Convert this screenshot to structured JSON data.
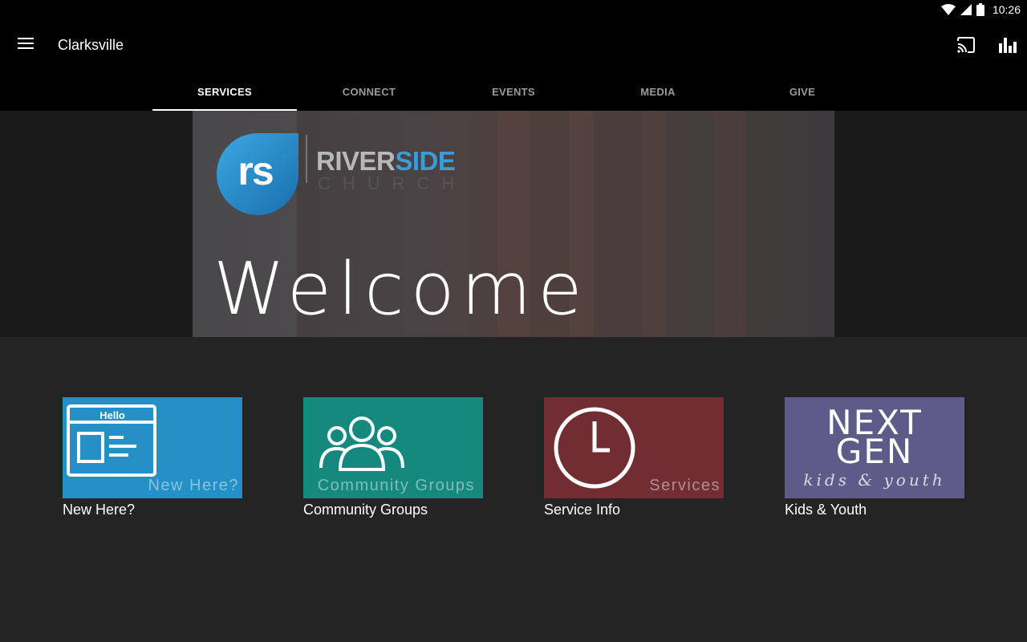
{
  "status_bar": {
    "time": "10:26"
  },
  "app_bar": {
    "title": "Clarksville",
    "icons": {
      "menu": "menu-icon",
      "cast": "cast-icon",
      "stats": "bar-chart-icon"
    }
  },
  "tabs": [
    {
      "label": "SERVICES",
      "active": true
    },
    {
      "label": "CONNECT",
      "active": false
    },
    {
      "label": "EVENTS",
      "active": false
    },
    {
      "label": "MEDIA",
      "active": false
    },
    {
      "label": "GIVE",
      "active": false
    }
  ],
  "hero": {
    "logo_mark": "rs",
    "brand_part1": "RIVER",
    "brand_part2": "SIDE",
    "brand_sub": "CHURCH",
    "headline": "Welcome"
  },
  "tiles": [
    {
      "label": "New Here?",
      "caption": "New Here?",
      "badge": "Hello",
      "color": "#2491c6",
      "icon": "hello-card-icon"
    },
    {
      "label": "Community Groups",
      "caption": "Community Groups",
      "color": "#15897e",
      "icon": "people-group-icon"
    },
    {
      "label": "Service Info",
      "caption": "Services",
      "color": "#722d33",
      "icon": "clock-icon"
    },
    {
      "label": "Kids & Youth",
      "caption_top": "NEXT",
      "caption_mid": "GEN",
      "caption_sub": "kids & youth",
      "color": "#5f5b88",
      "icon": "next-gen-logo"
    }
  ],
  "colors": {
    "accent_blue": "#3d9bd6",
    "background": "#242424",
    "bar": "#000000"
  }
}
